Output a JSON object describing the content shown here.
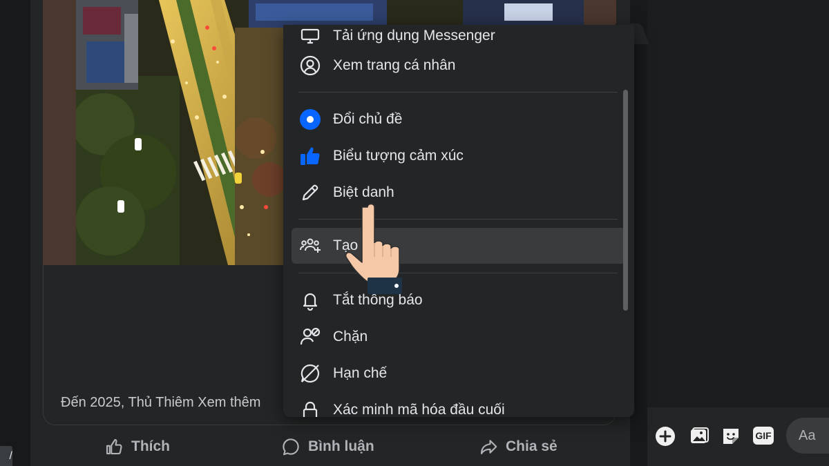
{
  "post": {
    "caption_text": "Đến 2025, Thủ Thiêm Xem thêm",
    "actions": {
      "like": "Thích",
      "comment": "Bình luận",
      "share": "Chia sẻ"
    }
  },
  "edge_tag_text": "/",
  "menu": {
    "items": [
      {
        "key": "messenger_app",
        "label": "Tải ứng dụng Messenger",
        "icon": "monitor-icon"
      },
      {
        "key": "view_profile",
        "label": "Xem trang cá nhân",
        "icon": "profile-circle-icon"
      },
      {
        "key": "change_theme",
        "label": "Đổi chủ đề",
        "icon": "theme-dot-icon"
      },
      {
        "key": "reaction_emoji",
        "label": "Biểu tượng cảm xúc",
        "icon": "thumbs-up-icon"
      },
      {
        "key": "nickname",
        "label": "Biệt danh",
        "icon": "pencil-icon"
      },
      {
        "key": "create_group",
        "label": "Tạo n",
        "icon": "people-add-icon",
        "highlighted": true
      },
      {
        "key": "mute",
        "label": "Tắt thông báo",
        "icon": "bell-icon"
      },
      {
        "key": "block",
        "label": "Chặn",
        "icon": "block-person-icon"
      },
      {
        "key": "restrict",
        "label": "Hạn chế",
        "icon": "restrict-icon"
      },
      {
        "key": "verify_encryption",
        "label": "Xác minh mã hóa đầu cuối",
        "icon": "lock-icon"
      }
    ]
  },
  "composer": {
    "gif_label": "GIF",
    "input_placeholder": "Aa",
    "buttons": [
      "plus-circle-icon",
      "photo-icon",
      "sticker-icon",
      "gif-icon"
    ]
  },
  "colors": {
    "accent_blue": "#0866ff",
    "menu_bg": "#242526",
    "page_bg": "#18191a",
    "text_primary": "#e4e6eb",
    "text_secondary": "#b0b3b8",
    "highlight_row": "#3a3b3c"
  }
}
